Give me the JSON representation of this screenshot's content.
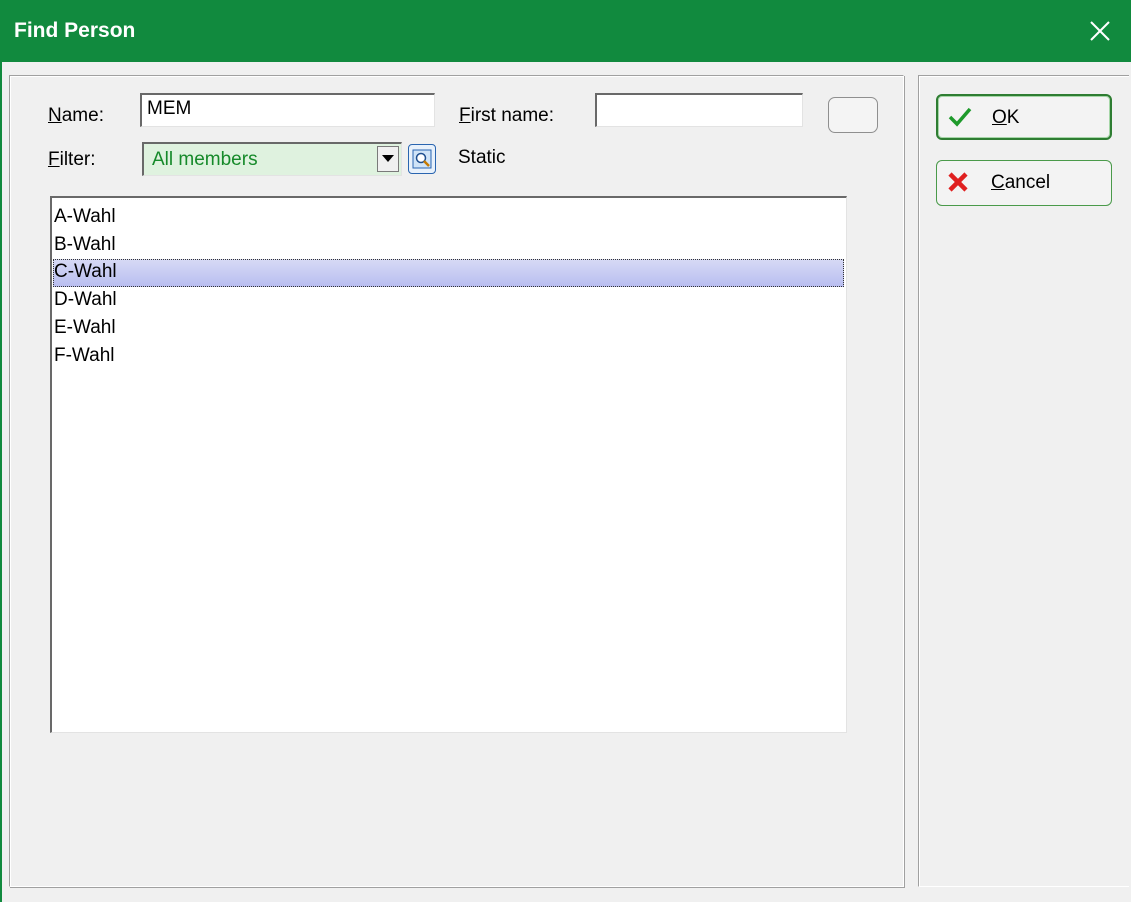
{
  "window": {
    "title": "Find Person"
  },
  "form": {
    "name_label_first": "N",
    "name_label_rest": "ame:",
    "name_value": "MEM",
    "first_name_label_first": "F",
    "first_name_label_rest": "irst name:",
    "first_name_value": "",
    "filter_label_first": "F",
    "filter_label_rest": "ilter:",
    "filter_value": "All members",
    "static_label": "Static"
  },
  "list": {
    "items": [
      "A-Wahl",
      "B-Wahl",
      "C-Wahl",
      "D-Wahl",
      "E-Wahl",
      "F-Wahl"
    ],
    "selected": "C-Wahl"
  },
  "buttons": {
    "ok_first": "O",
    "ok_rest": "K",
    "cancel_first": "C",
    "cancel_rest": "ancel"
  },
  "icons": {
    "close": "close-icon",
    "check": "checkmark-icon",
    "cancel": "red-x-icon",
    "search": "search-icon",
    "dropdown": "dropdown-arrow-icon"
  },
  "colors": {
    "titlebar": "#118a3e",
    "selection": "#b8bdf0",
    "combo_text": "#168a2a"
  }
}
